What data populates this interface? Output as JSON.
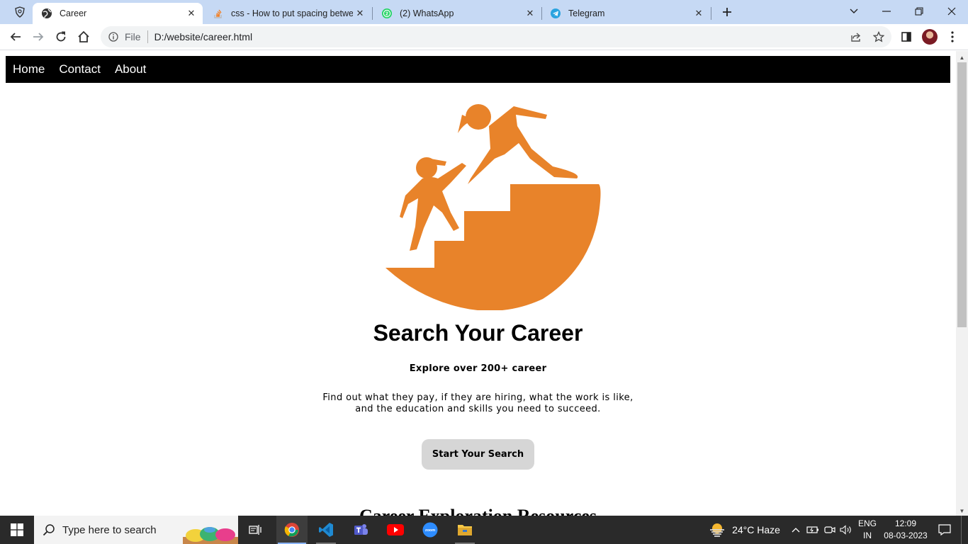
{
  "browser": {
    "tabs": [
      {
        "title": "Career",
        "active": true,
        "icon": "globe-icon"
      },
      {
        "title": "css - How to put spacing betwee",
        "active": false,
        "icon": "stackoverflow-icon"
      },
      {
        "title": "(2) WhatsApp",
        "active": false,
        "icon": "whatsapp-icon"
      },
      {
        "title": "Telegram",
        "active": false,
        "icon": "telegram-icon"
      }
    ],
    "address": {
      "scheme_label": "File",
      "url": "D:/website/career.html"
    }
  },
  "page": {
    "nav": [
      "Home",
      "Contact",
      "About"
    ],
    "hero": {
      "title": "Search Your Career",
      "subtitle": "Explore over 200+ career",
      "description_line1": "Find out what they pay, if they are hiring, what the work is like,",
      "description_line2": "and the education and skills you need to succeed.",
      "button_label": "Start Your Search",
      "image_color": "#e8832a"
    },
    "next_section_title": "Career Exploration Resources"
  },
  "taskbar": {
    "search_placeholder": "Type here to search",
    "weather": "24°C  Haze",
    "language_line1": "ENG",
    "language_line2": "IN",
    "time": "12:09",
    "date": "08-03-2023"
  }
}
